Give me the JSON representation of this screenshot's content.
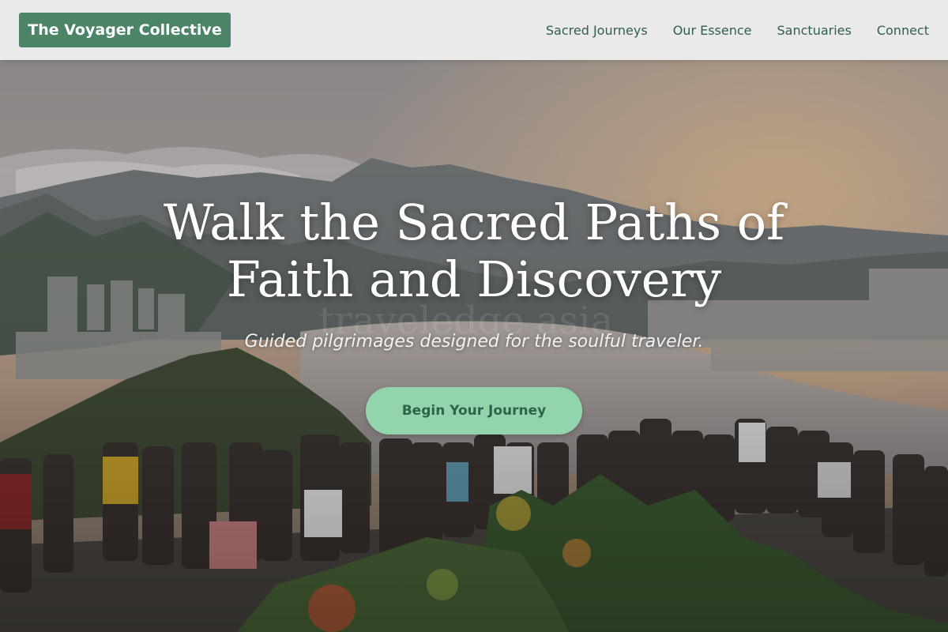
{
  "header": {
    "brand": "The Voyager Collective",
    "nav": [
      {
        "label": "Sacred Journeys"
      },
      {
        "label": "Our Essence"
      },
      {
        "label": "Sanctuaries"
      },
      {
        "label": "Connect"
      }
    ]
  },
  "hero": {
    "title_line1": "Walk the Sacred Paths of",
    "title_line2": "Faith and Discovery",
    "subtitle": "Guided pilgrimages designed for the soulful traveler.",
    "cta_label": "Begin Your Journey",
    "watermark": "traveledge asia",
    "image": "mountain-overlook-crowd-sunset"
  },
  "colors": {
    "brand_bg": "#4b8466",
    "nav_text": "#2f6049",
    "cta_bg": "#92d5ad",
    "cta_text": "#2c6447"
  }
}
